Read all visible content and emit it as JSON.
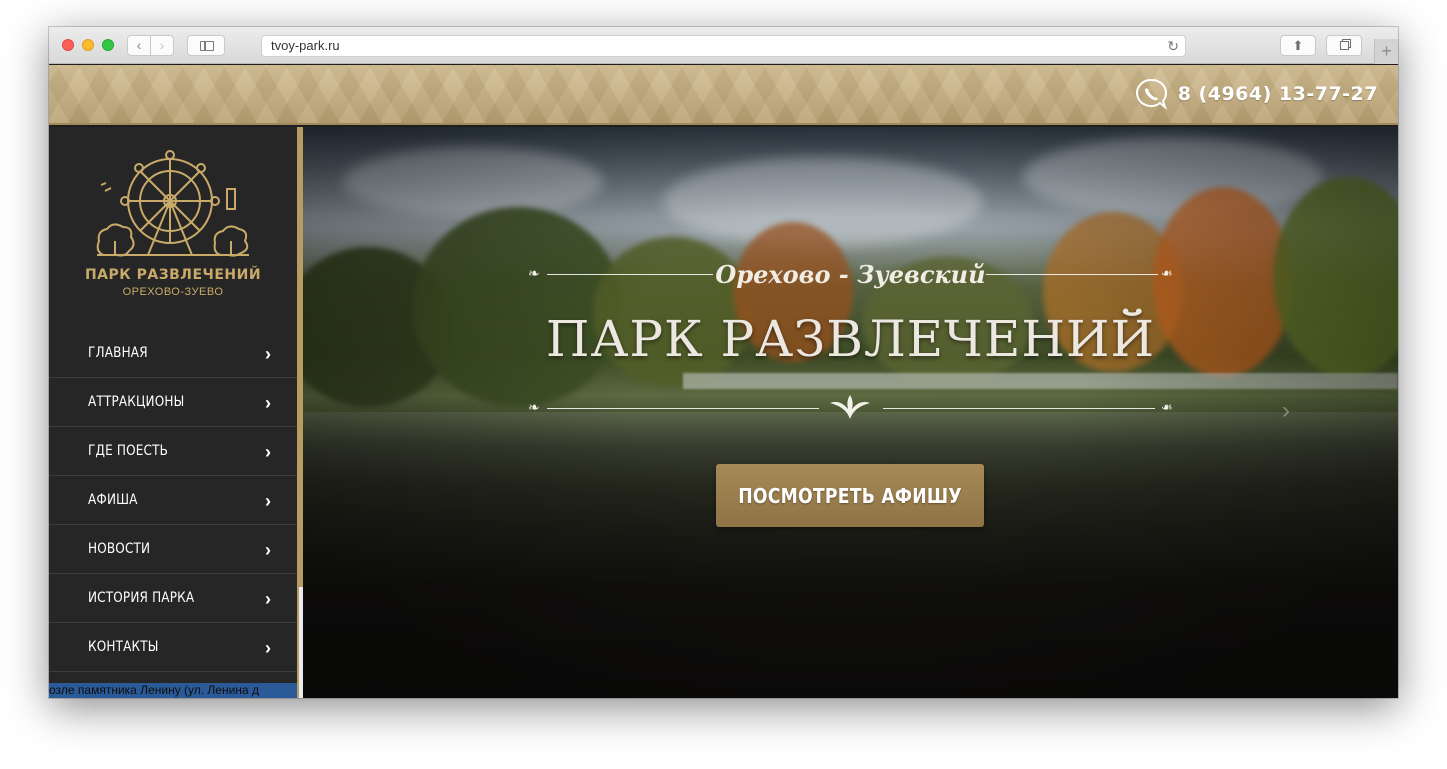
{
  "browser": {
    "url": "tvoy-park.ru",
    "icons": {
      "back": "chevron-left-icon",
      "forward": "chevron-right-icon",
      "sidebar": "sidebar-icon",
      "reload": "reload-icon",
      "share": "share-icon",
      "tabs": "tabs-icon",
      "new_tab": "plus-icon"
    }
  },
  "header": {
    "phone": "8 (4964) 13-77-27",
    "phone_icon": "phone-chat-icon",
    "background_color": "#c4ad7e"
  },
  "logo": {
    "title": "ПАРК РАЗВЛЕЧЕНИЙ",
    "subtitle": "ОРЕХОВО-ЗУЕВО",
    "icon": "ferris-wheel-icon",
    "color": "#c9aa69"
  },
  "menu": {
    "items": [
      {
        "label": "ГЛАВНАЯ"
      },
      {
        "label": "АТТРАКЦИОНЫ"
      },
      {
        "label": "ГДЕ ПОЕСТЬ"
      },
      {
        "label": "АФИША"
      },
      {
        "label": "НОВОСТИ"
      },
      {
        "label": "ИСТОРИЯ ПАРКА"
      },
      {
        "label": "КОНТАКТЫ"
      }
    ],
    "chevron_icon": "chevron-right-icon"
  },
  "sidebar_footer": {
    "text": "озле памятника Ленину (ул. Ленина д"
  },
  "hero": {
    "subtitle": "Орехово - Зуевский",
    "title": "ПАРК РАЗВЛЕЧЕНИЙ",
    "cta_label": "ПОСМОТРЕТЬ АФИШУ",
    "ornament_icon": "fleur-icon",
    "leaf_icon": "leaf-icon",
    "accent_color": "#a68a58"
  }
}
